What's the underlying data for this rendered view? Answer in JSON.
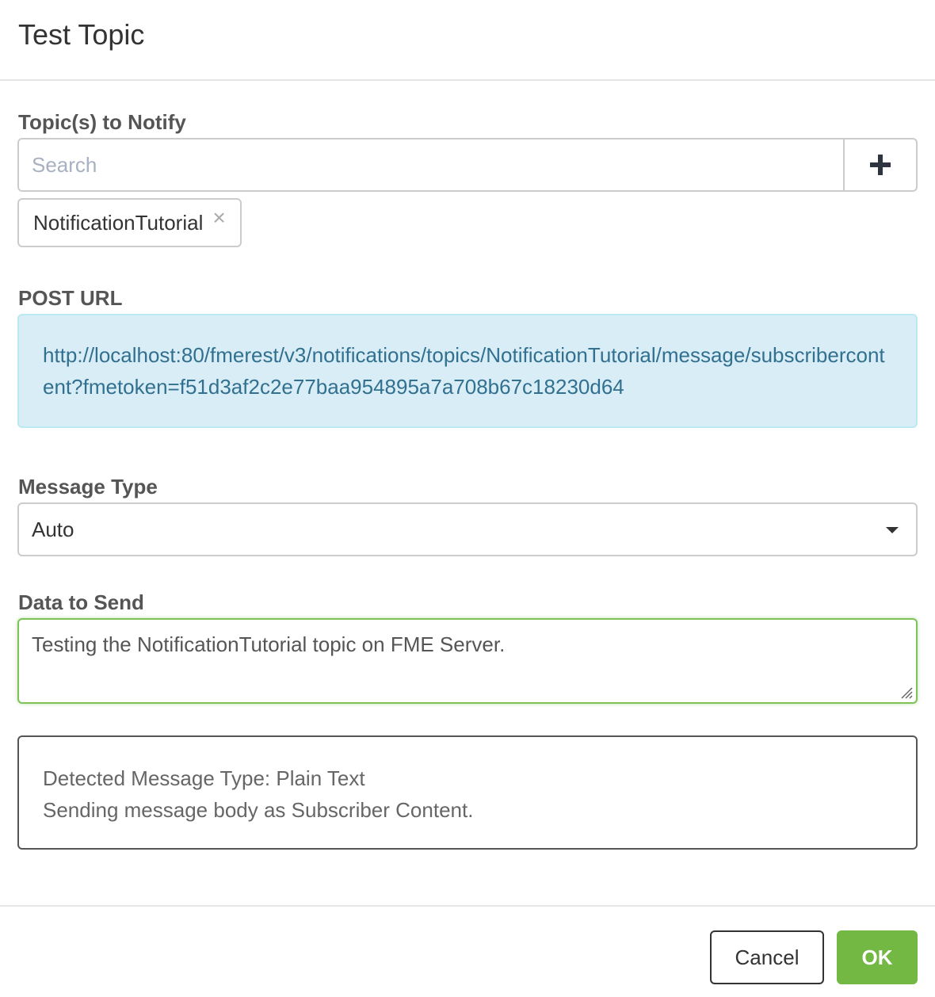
{
  "dialog": {
    "title": "Test Topic"
  },
  "topics": {
    "label": "Topic(s) to Notify",
    "search_placeholder": "Search",
    "selected": [
      "NotificationTutorial"
    ]
  },
  "post_url": {
    "label": "POST URL",
    "value": "http://localhost:80/fmerest/v3/notifications/topics/NotificationTutorial/message/subscribercontent?fmetoken=f51d3af2c2e77baa954895a7a708b67c18230d64"
  },
  "message_type": {
    "label": "Message Type",
    "selected": "Auto"
  },
  "data_to_send": {
    "label": "Data to Send",
    "value": "Testing the NotificationTutorial topic on FME Server."
  },
  "detection": {
    "line1": "Detected Message Type: Plain Text",
    "line2": "Sending message body as Subscriber Content."
  },
  "buttons": {
    "cancel": "Cancel",
    "ok": "OK"
  },
  "colors": {
    "ok_green": "#72b842",
    "info_blue_bg": "#d9edf7",
    "info_blue_text": "#31708f",
    "focus_green": "#7dc35a"
  }
}
